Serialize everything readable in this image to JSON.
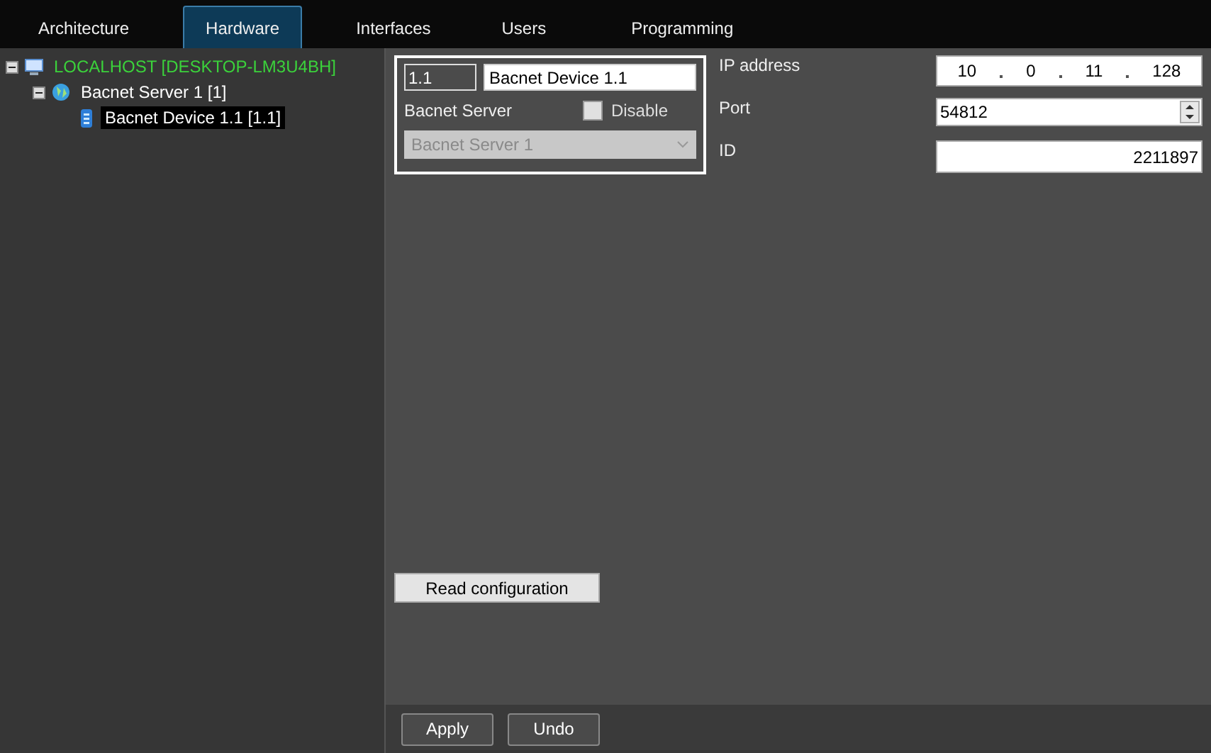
{
  "tabs": [
    {
      "label": "Architecture",
      "selected": false
    },
    {
      "label": "Hardware",
      "selected": true
    },
    {
      "label": "Interfaces",
      "selected": false
    },
    {
      "label": "Users",
      "selected": false
    },
    {
      "label": "Programming",
      "selected": false
    }
  ],
  "tree": [
    {
      "label": "LOCALHOST [DESKTOP-LM3U4BH]",
      "kind": "host",
      "expanded": true,
      "selected": false,
      "children": [
        {
          "label": "Bacnet Server 1 [1]",
          "kind": "server",
          "expanded": true,
          "selected": false,
          "children": [
            {
              "label": "Bacnet Device 1.1 [1.1]",
              "kind": "device",
              "selected": true
            }
          ]
        }
      ]
    }
  ],
  "device": {
    "number": "1.1",
    "name": "Bacnet Device 1.1",
    "server_label": "Bacnet Server",
    "disable_label": "Disable",
    "disable_checked": false,
    "server_value": "Bacnet Server 1"
  },
  "ip": {
    "label": "IP address",
    "octets": [
      "10",
      "0",
      "11",
      "128"
    ]
  },
  "port": {
    "label": "Port",
    "value": "54812"
  },
  "id": {
    "label": "ID",
    "value": "2211897"
  },
  "read_button": "Read configuration",
  "buttons": [
    "Apply",
    "Undo"
  ]
}
